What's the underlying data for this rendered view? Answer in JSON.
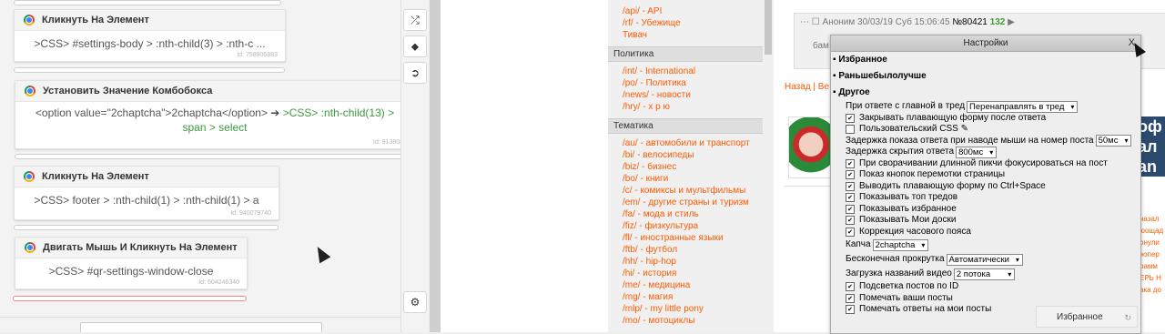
{
  "editor": {
    "steps": [
      {
        "title": "Кликнуть На Элемент",
        "body": ">CSS> #settings-body > :nth-child(3) > :nth-c ...",
        "body_green": "",
        "id": "Id: 758906883"
      },
      {
        "title": "Установить Значение Комбобокса",
        "body": "<option value=\"2chaptcha\">2chaptcha</option> ",
        "body_green": ">CSS> :nth-child(13) > span > select",
        "id": "Id: 9138080"
      },
      {
        "title": "Кликнуть На Элемент",
        "body": ">CSS> footer > :nth-child(1) > :nth-child(1) > a",
        "body_green": "",
        "id": "Id: 940079740"
      },
      {
        "title": "Двигать Мышь И Кликнуть На Элемент",
        "body": ">CSS> #qr-settings-window-close",
        "body_green": "",
        "id": "Id: 604246340"
      }
    ],
    "tool_icons": [
      "shuffle-icon",
      "tag-icon",
      "arrow-circle-icon",
      "bug-icon"
    ]
  },
  "board": {
    "top_links": [
      "/api/ - API",
      "/rf/ - Убежище",
      "Тивач"
    ],
    "sections": [
      {
        "title": "Политика",
        "links": [
          "/int/ - International",
          "/po/ - Политика",
          "/news/ - новости",
          "/hry/ - х р ю"
        ]
      },
      {
        "title": "Тематика",
        "links": [
          "/au/ - автомобили и транспорт",
          "/bi/ - велосипеды",
          "/biz/ - бизнес",
          "/bo/ - книги",
          "/c/ - комиксы и мультфильмы",
          "/em/ - другие страны и туризм",
          "/fa/ - мода и стиль",
          "/fiz/ - физкультура",
          "/fl/ - иностранные языки",
          "/ftb/ - футбол",
          "/hh/ - hip-hop",
          "/hi/ - история",
          "/me/ - медицина",
          "/mg/ - магия",
          "/mlp/ - my little pony",
          "/mo/ - мотоциклы"
        ]
      }
    ]
  },
  "post": {
    "meta": "Аноним 30/03/19 Суб 15:06:45",
    "number": "№80421",
    "count": "132",
    "body": "бам",
    "nav": "Назад | Ве"
  },
  "settings": {
    "title": "Настройки",
    "close": "X",
    "sections": [
      "Избранное",
      "Раньшебылолучше",
      "Другое"
    ],
    "rows": [
      {
        "type": "select",
        "label": "При ответе с главной в тред",
        "value": "Перенаправлять в тред"
      },
      {
        "type": "check",
        "checked": true,
        "label": "Закрывать плавающую форму после ответа"
      },
      {
        "type": "check",
        "checked": false,
        "label": "Пользовательский CSS"
      },
      {
        "type": "select",
        "label": "Задержка показа ответа при наводе мыши на номер поста",
        "value": "50мс"
      },
      {
        "type": "select",
        "label": "Задержка скрытия ответа",
        "value": "800мс"
      },
      {
        "type": "check",
        "checked": true,
        "label": "При сворачивании длинной пикчи фокусироваться на пост"
      },
      {
        "type": "check",
        "checked": true,
        "label": "Показ кнопок перемотки страницы"
      },
      {
        "type": "check",
        "checked": true,
        "label": "Выводить плавающую форму по Ctrl+Space"
      },
      {
        "type": "check",
        "checked": true,
        "label": "Показывать топ тредов"
      },
      {
        "type": "check",
        "checked": true,
        "label": "Показывать избранное"
      },
      {
        "type": "check",
        "checked": true,
        "label": "Показывать Мои доски"
      },
      {
        "type": "check",
        "checked": true,
        "label": "Коррекция часового пояса"
      },
      {
        "type": "select",
        "label": "Капча",
        "value": "2chaptcha"
      },
      {
        "type": "select",
        "label": "Бесконечная прокрутка",
        "value": "Автоматически"
      },
      {
        "type": "select",
        "label": "Загрузка названий видео",
        "value": "2 потока"
      },
      {
        "type": "check",
        "checked": true,
        "label": "Подсветка постов по ID"
      },
      {
        "type": "check",
        "checked": true,
        "label": "Помечать ваши посты"
      },
      {
        "type": "check",
        "checked": true,
        "label": "Помечать ответы на мои посты"
      }
    ],
    "fav_tab": "Избранное"
  },
  "right_banner": "оф ал an",
  "right_text": "назал\nюощад\nонули\nэопер\nрамм\nЕРЬ Н\nака до"
}
